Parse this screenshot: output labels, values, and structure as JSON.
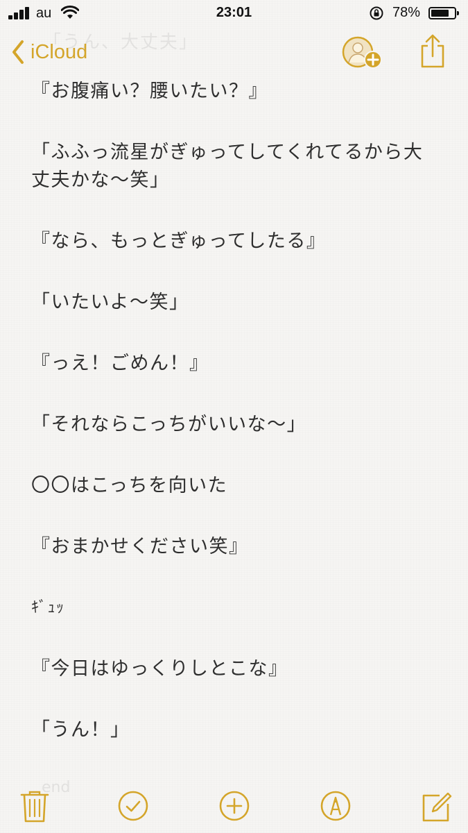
{
  "status_bar": {
    "carrier": "au",
    "time": "23:01",
    "battery_percent": "78%",
    "battery_level": 0.78
  },
  "nav": {
    "back_label": "iCloud",
    "ghost_text": "「うん、大丈夫」",
    "accent_color": "#d4a52a"
  },
  "note": {
    "lines": [
      "『お腹痛い？腰いたい？』",
      "「ふふっ流星がぎゅってしてくれてるから大",
      "丈夫かな〜笑」",
      "『なら、もっとぎゅってしたる』",
      "「いたいよ〜笑」",
      "『っえ！ごめん！』",
      "「それならこっちがいいな〜」",
      "〇〇はこっちを向いた",
      "『おまかせください笑』",
      "ｷﾞｭｯ",
      "『今日はゆっくりしとこな』",
      "「うん！」"
    ]
  },
  "toolbar": {
    "ghost_text": "end",
    "icons": [
      "trash-icon",
      "checklist-icon",
      "add-icon",
      "markup-icon",
      "compose-icon"
    ]
  }
}
